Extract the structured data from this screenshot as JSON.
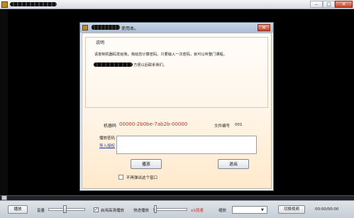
{
  "player": {
    "minimize_glyph": "–",
    "maximize_glyph": "□",
    "close_glyph": "✕"
  },
  "dialog": {
    "title_suffix": "使用本。",
    "close_glyph": "✕",
    "group_label": "说明",
    "instruction_line1": "请复制机器码发给我，我给您计算密码。只要输入一次密码，就可以听整门课程。",
    "instruction_line2": "，方便以后联系我们。",
    "machine_code_label": "机器码",
    "machine_code": "00000-2b0be-7ab2b-00000",
    "file_number_label": "文件编号",
    "file_number": "001",
    "password_label": "播放密码",
    "import_link": "导入授权",
    "password_value": "",
    "play_button": "播放",
    "exit_button": "退出",
    "no_popup_label": "不再弹出这个窗口"
  },
  "controls": {
    "play_button": "播放",
    "volume_label": "音量",
    "volume_level": 0.45,
    "hq_checked_glyph": "✓",
    "hq_label": "启用高清播放",
    "fast_forward_label": "快进播放",
    "speed_label": "x1倍速",
    "zoom_label": "缩放",
    "zoom_value": "",
    "switch_video_button": "切换视频",
    "time": "00:00/00:00"
  }
}
